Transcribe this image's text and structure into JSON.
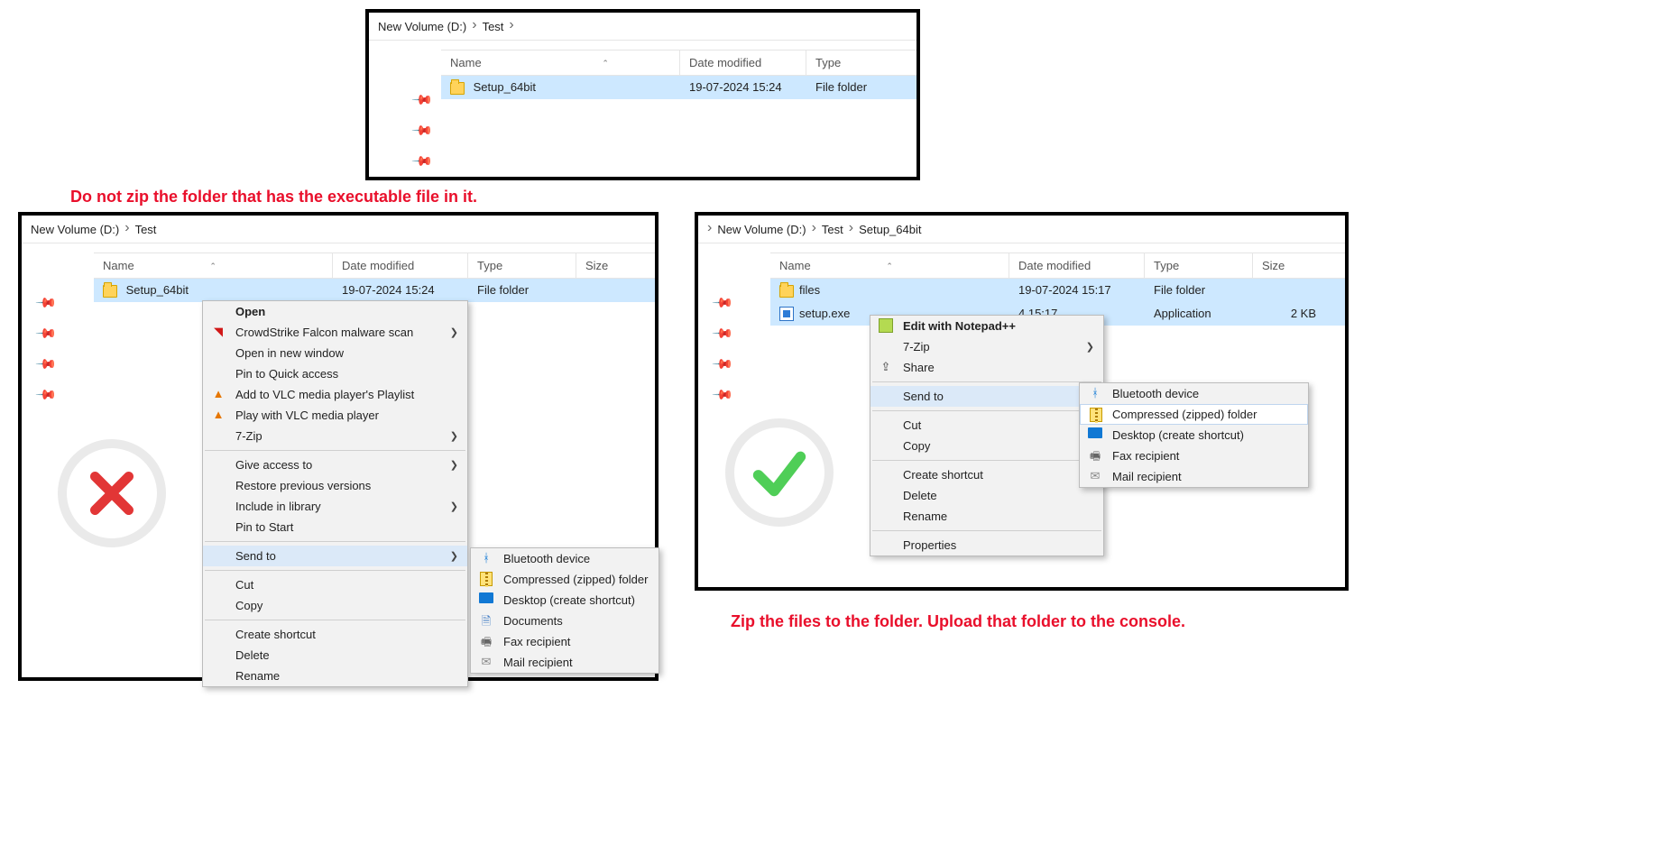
{
  "top_panel": {
    "crumbs": [
      "New Volume (D:)",
      "Test"
    ],
    "cols": {
      "name": "Name",
      "date": "Date modified",
      "type": "Type"
    },
    "row": {
      "name": "Setup_64bit",
      "date": "19-07-2024 15:24",
      "type": "File folder"
    }
  },
  "left_hint": "Do not zip the folder that has the executable file in it.",
  "left_panel": {
    "crumbs": [
      "New Volume (D:)",
      "Test"
    ],
    "cols": {
      "name": "Name",
      "date": "Date modified",
      "type": "Type",
      "size": "Size"
    },
    "row": {
      "name": "Setup_64bit",
      "date": "19-07-2024 15:24",
      "type": "File folder"
    },
    "ctx": [
      {
        "label": "Open",
        "bold": true
      },
      {
        "label": "CrowdStrike Falcon malware scan",
        "sub": true,
        "icon": "cs"
      },
      {
        "label": "Open in new window"
      },
      {
        "label": "Pin to Quick access"
      },
      {
        "label": "Add to VLC media player's Playlist",
        "icon": "vlc"
      },
      {
        "label": "Play with VLC media player",
        "icon": "vlc"
      },
      {
        "label": "7-Zip",
        "sub": true
      },
      {
        "sep": true
      },
      {
        "label": "Give access to",
        "sub": true
      },
      {
        "label": "Restore previous versions"
      },
      {
        "label": "Include in library",
        "sub": true
      },
      {
        "label": "Pin to Start"
      },
      {
        "sep": true
      },
      {
        "label": "Send to",
        "sub": true,
        "hov": true
      },
      {
        "sep": true
      },
      {
        "label": "Cut"
      },
      {
        "label": "Copy"
      },
      {
        "sep": true
      },
      {
        "label": "Create shortcut"
      },
      {
        "label": "Delete"
      },
      {
        "label": "Rename"
      }
    ],
    "sendto": [
      {
        "label": "Bluetooth device",
        "icon": "bt"
      },
      {
        "label": "Compressed (zipped) folder",
        "icon": "zip"
      },
      {
        "label": "Desktop (create shortcut)",
        "icon": "desk"
      },
      {
        "label": "Documents",
        "icon": "doc"
      },
      {
        "label": "Fax recipient",
        "icon": "fax"
      },
      {
        "label": "Mail recipient",
        "icon": "mail"
      }
    ]
  },
  "right_panel": {
    "crumbs": [
      "New Volume (D:)",
      "Test",
      "Setup_64bit"
    ],
    "cols": {
      "name": "Name",
      "date": "Date modified",
      "type": "Type",
      "size": "Size"
    },
    "rows": [
      {
        "kind": "folder",
        "name": "files",
        "date": "19-07-2024 15:17",
        "type": "File folder",
        "size": ""
      },
      {
        "kind": "exe",
        "name": "setup.exe",
        "date": "4 15:17",
        "type": "Application",
        "size": "2 KB"
      }
    ],
    "ctx": [
      {
        "label": "Edit with Notepad++",
        "bold": true,
        "icon": "np"
      },
      {
        "label": "7-Zip",
        "sub": true
      },
      {
        "label": "Share",
        "icon": "share"
      },
      {
        "sep": true
      },
      {
        "label": "Send to",
        "sub": true,
        "hov": true
      },
      {
        "sep": true
      },
      {
        "label": "Cut"
      },
      {
        "label": "Copy"
      },
      {
        "sep": true
      },
      {
        "label": "Create shortcut"
      },
      {
        "label": "Delete"
      },
      {
        "label": "Rename"
      },
      {
        "sep": true
      },
      {
        "label": "Properties"
      }
    ],
    "sendto": [
      {
        "label": "Bluetooth device",
        "icon": "bt"
      },
      {
        "label": "Compressed (zipped) folder",
        "icon": "zip",
        "hov": true
      },
      {
        "label": "Desktop (create shortcut)",
        "icon": "desk"
      },
      {
        "label": "Fax recipient",
        "icon": "fax"
      },
      {
        "label": "Mail recipient",
        "icon": "mail"
      }
    ]
  },
  "right_hint": "Zip the files to the folder. Upload that folder to the console."
}
